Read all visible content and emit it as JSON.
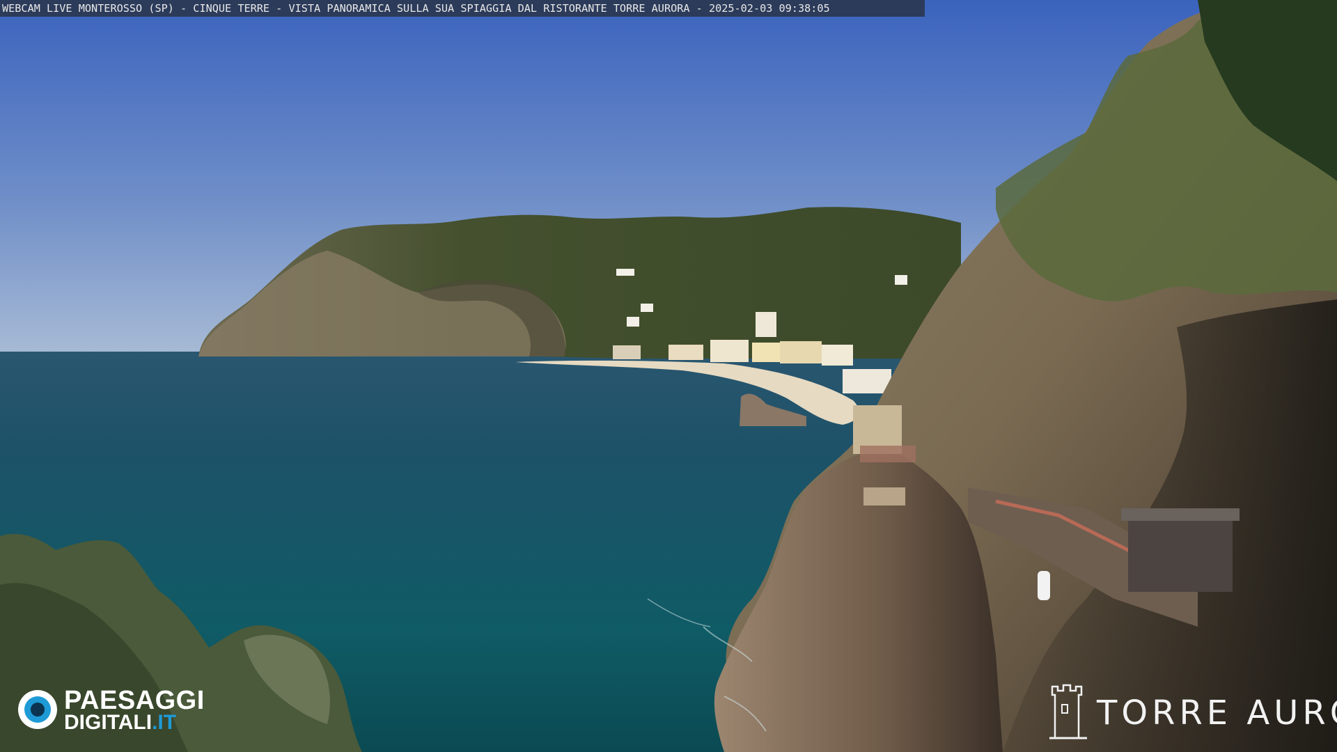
{
  "overlay": {
    "caption": "WEBCAM LIVE MONTEROSSO (SP) - CINQUE TERRE - VISTA PANORAMICA SULLA SUA SPIAGGIA DAL RISTORANTE TORRE AURORA - 2025-02-03 09:38:05"
  },
  "logos": {
    "left_brand_top": "PAESAGGI",
    "left_brand_bottom": "DIGITALI",
    "left_brand_tld": ".IT",
    "right_brand": "TORRE AURORA"
  },
  "colors": {
    "sky_top": "#3f68c0",
    "sky_horizon": "#a9bcd6",
    "sea_far": "#1e4f66",
    "sea_near": "#0f5a66",
    "headland": "#4a5232",
    "cliff_rock": "#8c7a64",
    "beach": "#e8dcc4",
    "brand_blue": "#1e9ad6"
  }
}
